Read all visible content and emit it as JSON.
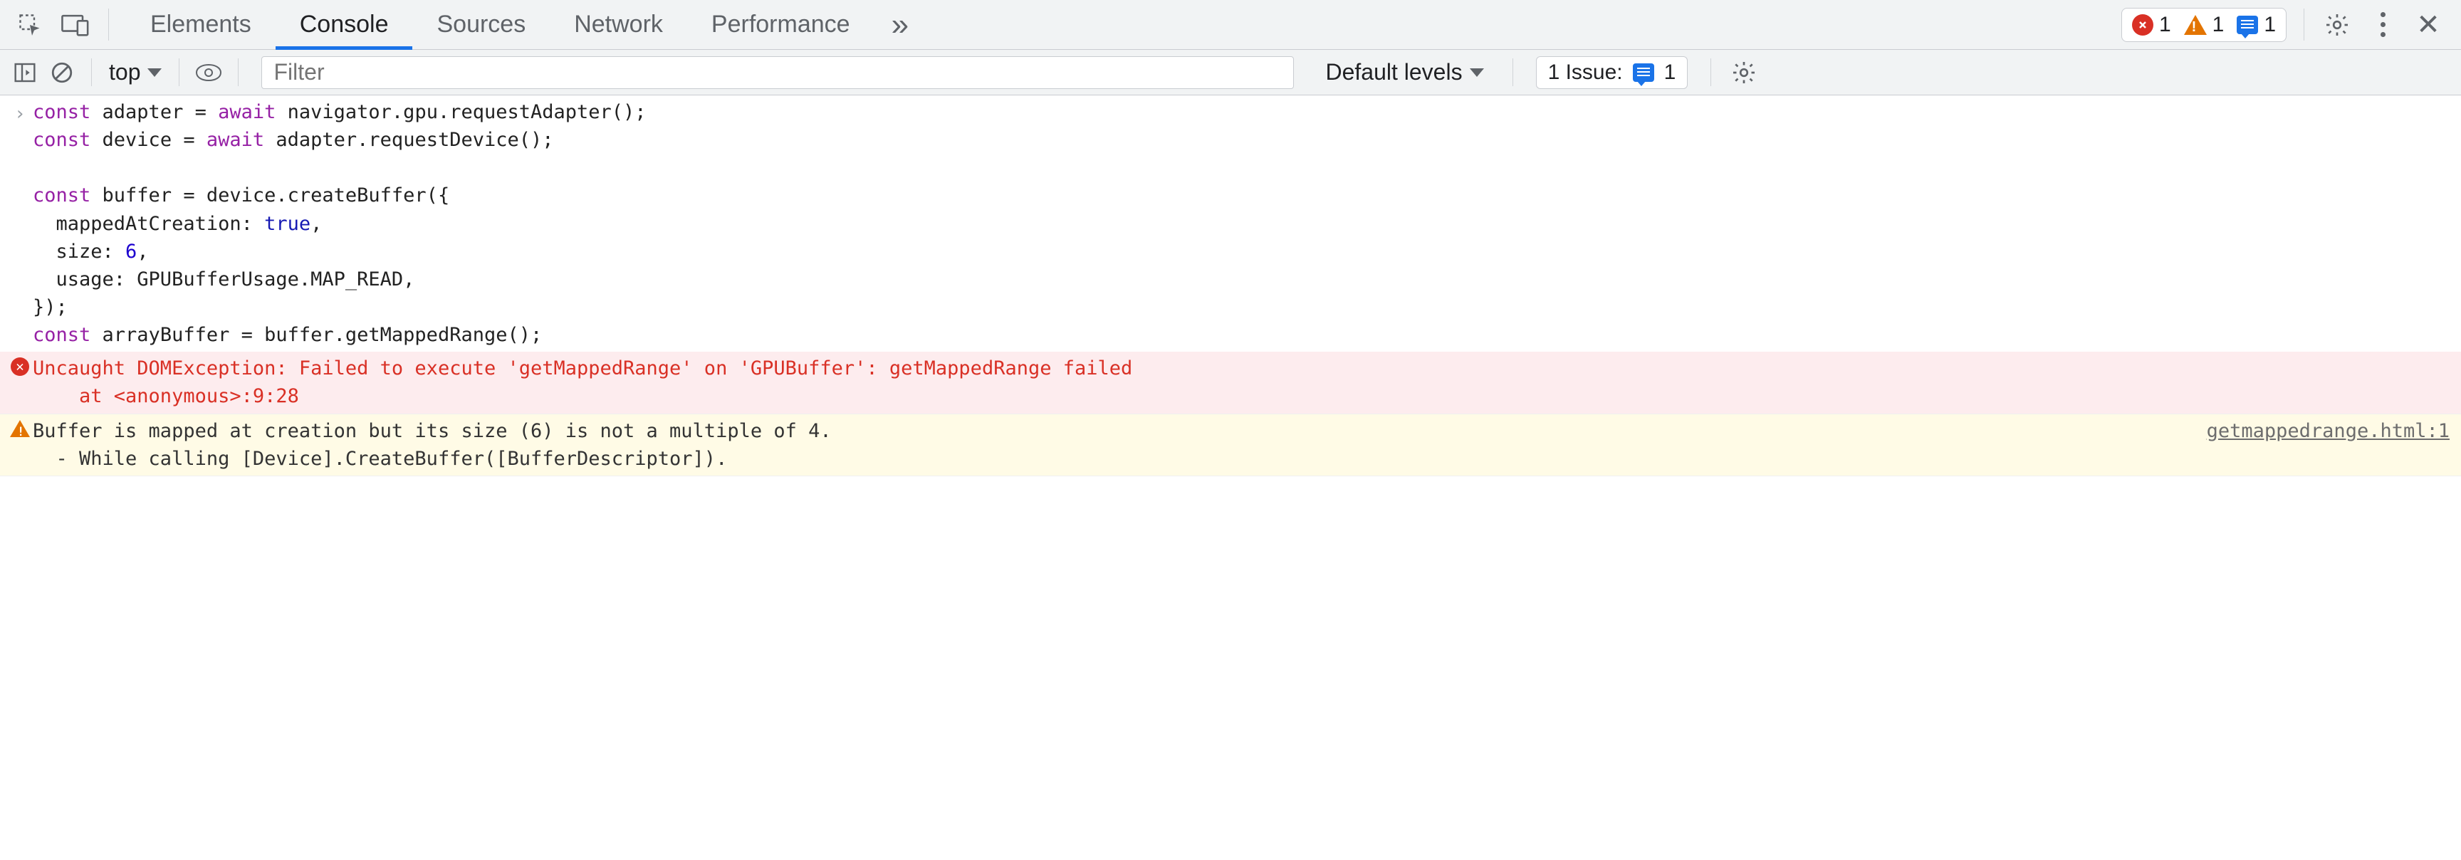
{
  "tabs": {
    "items": [
      "Elements",
      "Console",
      "Sources",
      "Network",
      "Performance"
    ],
    "active": 1
  },
  "badges": {
    "errors": "1",
    "warnings": "1",
    "info": "1"
  },
  "console_toolbar": {
    "context": "top",
    "filter_placeholder": "Filter",
    "levels_label": "Default levels",
    "issues_label": "1 Issue:",
    "issues_count": "1"
  },
  "code": {
    "l1a": "const",
    "l1b": " adapter = ",
    "l1c": "await",
    "l1d": " navigator.gpu.requestAdapter();",
    "l2a": "const",
    "l2b": " device = ",
    "l2c": "await",
    "l2d": " adapter.requestDevice();",
    "l3": "",
    "l4a": "const",
    "l4b": " buffer = device.createBuffer({",
    "l5a": "  mappedAtCreation: ",
    "l5b": "true",
    "l5c": ",",
    "l6a": "  size: ",
    "l6b": "6",
    "l6c": ",",
    "l7": "  usage: GPUBufferUsage.MAP_READ,",
    "l8": "});",
    "l9a": "const",
    "l9b": " arrayBuffer = buffer.getMappedRange();"
  },
  "error": {
    "line1": "Uncaught DOMException: Failed to execute 'getMappedRange' on 'GPUBuffer': getMappedRange failed",
    "line2": "    at <anonymous>:9:28"
  },
  "warning": {
    "loc": "getmappedrange.html:1",
    "line1": "Buffer is mapped at creation but its size (6) is not a multiple of 4.",
    "line2": "  - While calling [Device].CreateBuffer([BufferDescriptor])."
  }
}
